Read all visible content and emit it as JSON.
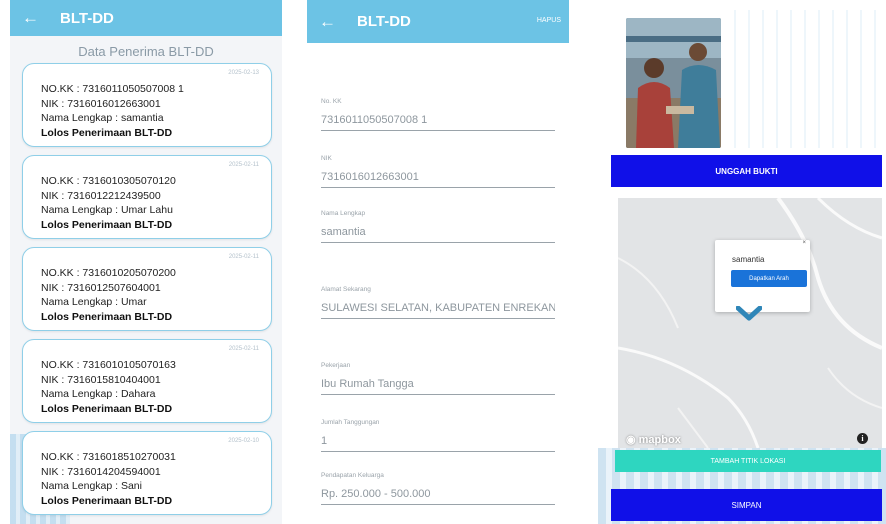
{
  "screen1": {
    "title": "BLT-DD",
    "heading": "Data Penerima BLT-DD",
    "cards": [
      {
        "date": "2025-02-13",
        "kk": "NO.KK : 7316011050507008 1",
        "nik": "NIK : 7316016012663001",
        "nama": "Nama Lengkap : samantia",
        "status": "Lolos Penerimaan BLT-DD"
      },
      {
        "date": "2025-02-11",
        "kk": "NO.KK : 7316010305070120",
        "nik": "NIK : 7316012212439500",
        "nama": "Nama Lengkap : Umar Lahu",
        "status": "Lolos Penerimaan BLT-DD"
      },
      {
        "date": "2025-02-11",
        "kk": "NO.KK : 7316010205070200",
        "nik": "NIK : 7316012507604001",
        "nama": "Nama Lengkap : Umar",
        "status": "Lolos Penerimaan BLT-DD"
      },
      {
        "date": "2025-02-11",
        "kk": "NO.KK : 7316010105070163",
        "nik": "NIK : 7316015810404001",
        "nama": "Nama Lengkap : Dahara",
        "status": "Lolos Penerimaan BLT-DD"
      },
      {
        "date": "2025-02-10",
        "kk": "NO.KK : 7316018510270031",
        "nik": "NIK : 7316014204594001",
        "nama": "Nama Lengkap : Sani",
        "status": "Lolos Penerimaan BLT-DD"
      }
    ]
  },
  "screen2": {
    "title": "BLT-DD",
    "hapus": "HAPUS",
    "fields": [
      {
        "label": "No. KK",
        "value": "7316011050507008 1"
      },
      {
        "label": "NIK",
        "value": "7316016012663001"
      },
      {
        "label": "Nama Lengkap",
        "value": "samantia"
      },
      {
        "label": "Alamat Sekarang",
        "value": "SULAWESI SELATAN, KABUPATEN ENREKANG, M..."
      },
      {
        "label": "Pekerjaan",
        "value": "Ibu Rumah Tangga"
      },
      {
        "label": "Jumlah Tanggungan",
        "value": "1"
      },
      {
        "label": "Pendapatan Keluarga",
        "value": "Rp. 250.000 - 500.000"
      }
    ]
  },
  "screen3": {
    "upload_label": "UNGGAH BUKTI",
    "popup_name": "samantia",
    "popup_button": "Dapatkan Arah",
    "mapbox_logo": "mapbox",
    "add_location_label": "TAMBAH TITIK LOKASI",
    "save_label": "SIMPAN",
    "colors": {
      "primary_button": "#1010e8",
      "teal_button": "#2ed6c0",
      "appbar": "#6cc3e5"
    }
  }
}
